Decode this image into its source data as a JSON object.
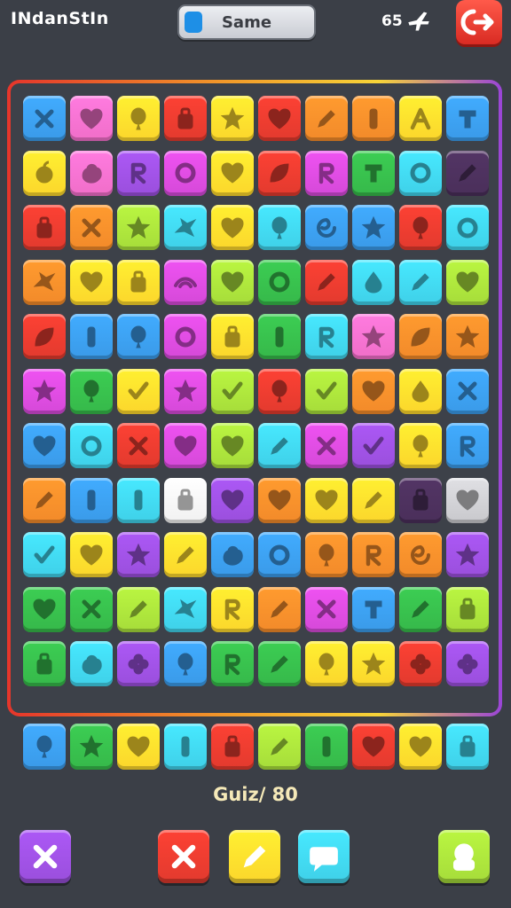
{
  "header": {
    "title": "INdanStIn",
    "game_button_label": "Same",
    "score": "65",
    "plane_icon": "airplane-icon",
    "exit_icon": "exit-icon"
  },
  "palette": {
    "blue": "#3a9ae8",
    "red": "#e23a2e",
    "pink": "#f06ec8",
    "yellow": "#fbd62c",
    "orange": "#f28a2a",
    "green": "#36b84a",
    "purple": "#9a4fdc",
    "cyan": "#3fd0e8",
    "lime": "#a6dc3a",
    "magenta": "#d549d8",
    "white": "#f1f1f1",
    "dark": "#4a2f5a",
    "gray": "#c8c8cc"
  },
  "board": {
    "rows": [
      [
        [
          "blue",
          "x"
        ],
        [
          "pink",
          "heart"
        ],
        [
          "yellow",
          "balloon"
        ],
        [
          "red",
          "bag"
        ],
        [
          "yellow",
          "star"
        ],
        [
          "red",
          "heart"
        ],
        [
          "orange",
          "pencil"
        ],
        [
          "orange",
          "bar"
        ],
        [
          "yellow",
          "letter-a"
        ],
        [
          "blue",
          "tee"
        ]
      ],
      [
        [
          "yellow",
          "apple"
        ],
        [
          "pink",
          "blob"
        ],
        [
          "purple",
          "letter-r"
        ],
        [
          "magenta",
          "ring"
        ],
        [
          "yellow",
          "heart"
        ],
        [
          "red",
          "leaf"
        ],
        [
          "magenta",
          "letter-r"
        ],
        [
          "green",
          "tee"
        ],
        [
          "cyan",
          "ring"
        ],
        [
          "dark",
          "pencil"
        ]
      ],
      [
        [
          "red",
          "bag"
        ],
        [
          "orange",
          "x"
        ],
        [
          "lime",
          "star"
        ],
        [
          "cyan",
          "bird"
        ],
        [
          "yellow",
          "heart"
        ],
        [
          "cyan",
          "balloon"
        ],
        [
          "blue",
          "swirl"
        ],
        [
          "blue",
          "star"
        ],
        [
          "red",
          "balloon"
        ],
        [
          "cyan",
          "ring"
        ]
      ],
      [
        [
          "orange",
          "bird"
        ],
        [
          "yellow",
          "heart"
        ],
        [
          "yellow",
          "bag"
        ],
        [
          "magenta",
          "wave"
        ],
        [
          "lime",
          "heart"
        ],
        [
          "green",
          "ring"
        ],
        [
          "red",
          "pencil"
        ],
        [
          "cyan",
          "drop"
        ],
        [
          "cyan",
          "pencil"
        ],
        [
          "lime",
          "heart"
        ]
      ],
      [
        [
          "red",
          "leaf"
        ],
        [
          "blue",
          "bar"
        ],
        [
          "blue",
          "balloon"
        ],
        [
          "magenta",
          "ring"
        ],
        [
          "yellow",
          "bag"
        ],
        [
          "green",
          "bar"
        ],
        [
          "cyan",
          "letter-r"
        ],
        [
          "pink",
          "star"
        ],
        [
          "orange",
          "leaf"
        ],
        [
          "orange",
          "star"
        ]
      ],
      [
        [
          "magenta",
          "star"
        ],
        [
          "green",
          "balloon"
        ],
        [
          "yellow",
          "check"
        ],
        [
          "magenta",
          "star"
        ],
        [
          "lime",
          "check"
        ],
        [
          "red",
          "balloon"
        ],
        [
          "lime",
          "check"
        ],
        [
          "orange",
          "heart"
        ],
        [
          "yellow",
          "drop"
        ],
        [
          "blue",
          "x"
        ]
      ],
      [
        [
          "blue",
          "heart"
        ],
        [
          "cyan",
          "ring"
        ],
        [
          "red",
          "x"
        ],
        [
          "magenta",
          "heart"
        ],
        [
          "lime",
          "heart"
        ],
        [
          "cyan",
          "pencil"
        ],
        [
          "magenta",
          "x"
        ],
        [
          "purple",
          "check"
        ],
        [
          "yellow",
          "balloon"
        ],
        [
          "blue",
          "letter-r"
        ]
      ],
      [
        [
          "orange",
          "pencil"
        ],
        [
          "blue",
          "bar"
        ],
        [
          "cyan",
          "bar"
        ],
        [
          "white",
          "bag"
        ],
        [
          "purple",
          "heart"
        ],
        [
          "orange",
          "heart"
        ],
        [
          "yellow",
          "heart"
        ],
        [
          "yellow",
          "pencil"
        ],
        [
          "dark",
          "bag"
        ],
        [
          "gray",
          "heart"
        ]
      ],
      [
        [
          "cyan",
          "check"
        ],
        [
          "yellow",
          "heart"
        ],
        [
          "purple",
          "star"
        ],
        [
          "yellow",
          "pencil"
        ],
        [
          "blue",
          "blob"
        ],
        [
          "blue",
          "ring"
        ],
        [
          "orange",
          "balloon"
        ],
        [
          "orange",
          "letter-r"
        ],
        [
          "orange",
          "swirl"
        ],
        [
          "purple",
          "star"
        ]
      ],
      [
        [
          "green",
          "heart"
        ],
        [
          "green",
          "x"
        ],
        [
          "lime",
          "pencil"
        ],
        [
          "cyan",
          "bird"
        ],
        [
          "yellow",
          "letter-r"
        ],
        [
          "orange",
          "pencil"
        ],
        [
          "magenta",
          "x"
        ],
        [
          "blue",
          "tee"
        ],
        [
          "green",
          "pencil"
        ],
        [
          "lime",
          "bag"
        ]
      ],
      [
        [
          "green",
          "bag"
        ],
        [
          "cyan",
          "blob"
        ],
        [
          "purple",
          "flower"
        ],
        [
          "blue",
          "balloon"
        ],
        [
          "green",
          "letter-r"
        ],
        [
          "green",
          "pencil"
        ],
        [
          "yellow",
          "balloon"
        ],
        [
          "yellow",
          "star"
        ],
        [
          "red",
          "flower"
        ],
        [
          "purple",
          "flower"
        ]
      ]
    ]
  },
  "tray": [
    [
      "blue",
      "balloon"
    ],
    [
      "green",
      "star"
    ],
    [
      "yellow",
      "heart"
    ],
    [
      "cyan",
      "bar"
    ],
    [
      "red",
      "bag"
    ],
    [
      "lime",
      "pencil"
    ],
    [
      "green",
      "bar"
    ],
    [
      "red",
      "heart"
    ],
    [
      "yellow",
      "heart"
    ],
    [
      "cyan",
      "bag"
    ]
  ],
  "caption": "Guiz/ 80",
  "bottom_buttons": [
    {
      "name": "close-button",
      "color": "purple",
      "icon": "x"
    },
    {
      "name": "cancel-button",
      "color": "red",
      "icon": "x"
    },
    {
      "name": "pencil-button",
      "color": "yellow",
      "icon": "pencil"
    },
    {
      "name": "chat-button",
      "color": "cyan",
      "icon": "chat"
    },
    {
      "name": "character-button",
      "color": "lime",
      "icon": "char"
    }
  ]
}
